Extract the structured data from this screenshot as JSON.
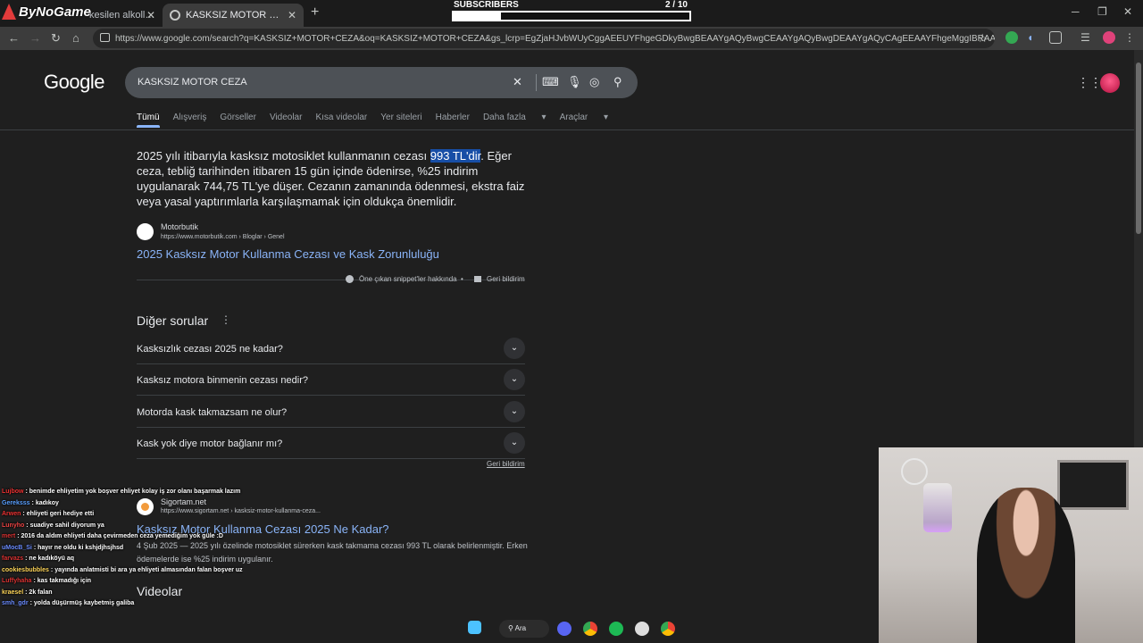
{
  "stream": {
    "logo_text": "ByNoGame",
    "subscribers_label": "SUBSCRIBERS",
    "subscribers_count": "2 / 10",
    "subscribers_progress": 0.2
  },
  "browser": {
    "tabs": [
      {
        "title": "kesilen alkollü s...",
        "active": false
      },
      {
        "title": "KASKSIZ MOTOR CEZA - Google",
        "active": true
      }
    ],
    "url": "https://www.google.com/search?q=KASKSIZ+MOTOR+CEZA&oq=KASKSIZ+MOTOR+CEZA&gs_lcrp=EgZjaHJvbWUyCggAEEUYFhgeGDkyBwgBEAAYgAQyBwgCEAAYgAQyBwgDEAAYgAQyCAgEEAAYFhgeMggIBRAAGBYYHjIICAYQAB..."
  },
  "google": {
    "logo": "Google",
    "query": "KASKSIZ MOTOR CEZA",
    "tabs": [
      "Tümü",
      "Alışveriş",
      "Görseller",
      "Videolar",
      "Kısa videolar",
      "Yer siteleri",
      "Haberler",
      "Daha fazla",
      "Araçlar"
    ],
    "featured": {
      "pre": "2025 yılı itibarıyla kasksız motosiklet kullanmanın cezası ",
      "highlight": "993 TL'dir",
      "post": ". Eğer ceza, tebliğ tarihinden itibaren 15 gün içinde ödenirse, %25 indirim uygulanarak 744,75 TL'ye düşer. Cezanın zamanında ödenmesi, ekstra faiz veya yasal yaptırımlarla karşılaşmamak için oldukça önemlidir.",
      "source_name": "Motorbutik",
      "source_url": "https://www.motorbutik.com › Bloglar › Genel",
      "link": "2025 Kasksız Motor Kullanma Cezası ve Kask Zorunluluğu",
      "about": "Öne çıkan snippet'ler hakkında",
      "feedback": "Geri bildirim"
    },
    "paa": {
      "title": "Diğer sorular",
      "questions": [
        "Kasksızlık cezası 2025 ne kadar?",
        "Kasksız motora binmenin cezası nedir?",
        "Motorda kask takmazsam ne olur?",
        "Kask yok diye motor bağlanır mı?"
      ],
      "feedback": "Geri bildirim"
    },
    "result2": {
      "source_name": "Sigortam.net",
      "source_url": "https://www.sigortam.net › kasksiz-motor-kullanma-ceza...",
      "link": "Kasksız Motor Kullanma Cezası 2025 Ne Kadar?",
      "desc": "4 Şub 2025 — 2025 yılı özelinde motosiklet sürerken kask takmama cezası 993 TL olarak belirlenmiştir. Erken ödemelerde ise %25 indirim uygulanır."
    },
    "videos_title": "Videolar"
  },
  "chat": [
    {
      "user": "Lujbow",
      "color": "#e33",
      "msg": "benimde ehliyetim yok boşver ehliyet kolay iş zor olanı başarmak lazım"
    },
    {
      "user": "Gereksss",
      "color": "#5aa0ff",
      "msg": "kadıkoy"
    },
    {
      "user": "Arwen",
      "color": "#e33",
      "msg": "ehliyeti geri hediye etti"
    },
    {
      "user": "Lunyho",
      "color": "#e44",
      "msg": "suadiye sahil diyorum ya"
    },
    {
      "user": "mert",
      "color": "#d33",
      "msg": "2016 da aldım ehliyeti daha çevirmeden ceza yemediğim yok güle :D"
    },
    {
      "user": "uMocB_Si",
      "color": "#6b8cff",
      "msg": "hayır ne oldu ki kshjdjhsjhsd"
    },
    {
      "user": "farvazs",
      "color": "#d33",
      "msg": "ne kadıköyü aq"
    },
    {
      "user": "cookiesbubbles",
      "color": "#ffd65a",
      "msg": "yayında anlatmisti bi ara ya ehliyeti almasından falan boşver uzun olay"
    },
    {
      "user": "Luffyhaha",
      "color": "#d33",
      "msg": "kas takmadığı için"
    },
    {
      "user": "kraesel",
      "color": "#ffd65a",
      "msg": "2k falan"
    },
    {
      "user": "smh_gdr",
      "color": "#6b8cff",
      "msg": "yolda düşürmüş kaybetmiş galiba"
    }
  ],
  "taskbar": {
    "search_label": "Ara"
  },
  "colors": {
    "link": "#8ab4f8",
    "highlight": "#174ea6",
    "page_bg": "#1f1f1f"
  }
}
